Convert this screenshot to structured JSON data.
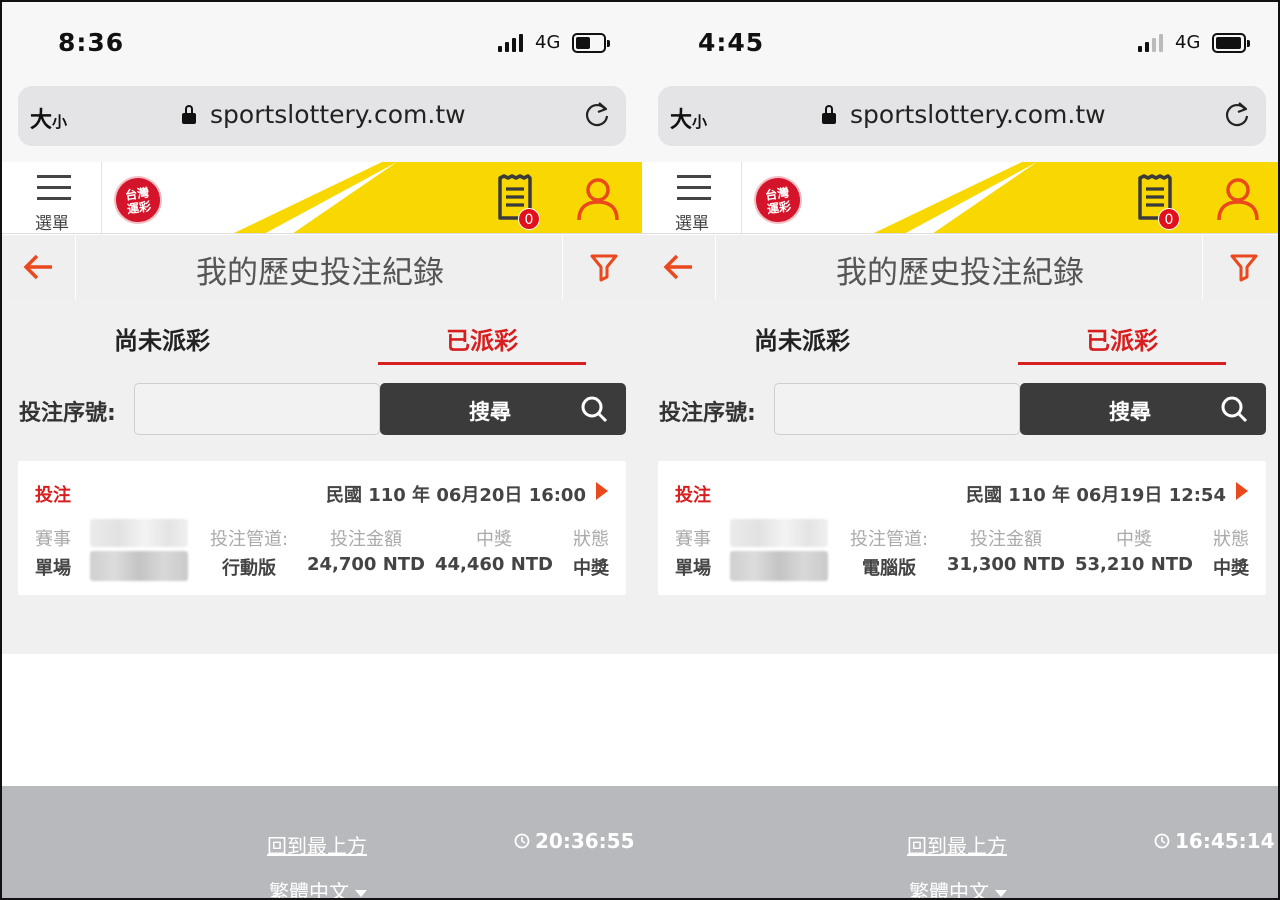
{
  "colors": {
    "accent_red": "#d71f1f",
    "orange": "#e9491c",
    "yellow": "#f8d800",
    "dark_button": "#3b3b3b",
    "footer_gray": "#b7b9bc"
  },
  "panes": [
    {
      "status": {
        "time": "8:36",
        "network": "4G",
        "battery_level": 0.55,
        "signal_bars_active": 4
      },
      "browser": {
        "text_size": "大",
        "text_size_small": "小",
        "url": "sportslottery.com.tw"
      },
      "header": {
        "menu_label": "選單",
        "logo_text": "台灣運彩",
        "cart_count": "0"
      },
      "page_title": "我的歷史投注紀錄",
      "tabs": {
        "pending": "尚未派彩",
        "settled": "已派彩"
      },
      "search": {
        "label": "投注序號:",
        "value": "",
        "button": "搜尋"
      },
      "record": {
        "type": "投注",
        "datetime": "民國 110 年 06月20日 16:00",
        "headers": {
          "event": "賽事",
          "channel": "投注管道:",
          "amount": "投注金額",
          "prize": "中獎",
          "status": "狀態"
        },
        "values": {
          "event": "單場",
          "channel": "行動版",
          "amount": "24,700 NTD",
          "prize": "44,460 NTD",
          "status": "中獎"
        }
      },
      "footer": {
        "back_to_top": "回到最上方",
        "clock": "20:36:55",
        "language": "繁體中文"
      }
    },
    {
      "status": {
        "time": "4:45",
        "network": "4G",
        "battery_level": 0.95,
        "signal_bars_active": 2
      },
      "browser": {
        "text_size": "大",
        "text_size_small": "小",
        "url": "sportslottery.com.tw"
      },
      "header": {
        "menu_label": "選單",
        "logo_text": "台灣運彩",
        "cart_count": "0"
      },
      "page_title": "我的歷史投注紀錄",
      "tabs": {
        "pending": "尚未派彩",
        "settled": "已派彩"
      },
      "search": {
        "label": "投注序號:",
        "value": "",
        "button": "搜尋"
      },
      "record": {
        "type": "投注",
        "datetime": "民國 110 年 06月19日 12:54",
        "headers": {
          "event": "賽事",
          "channel": "投注管道:",
          "amount": "投注金額",
          "prize": "中獎",
          "status": "狀態"
        },
        "values": {
          "event": "單場",
          "channel": "電腦版",
          "amount": "31,300 NTD",
          "prize": "53,210 NTD",
          "status": "中獎"
        }
      },
      "footer": {
        "back_to_top": "回到最上方",
        "clock": "16:45:14",
        "language": "繁體中文"
      }
    }
  ]
}
